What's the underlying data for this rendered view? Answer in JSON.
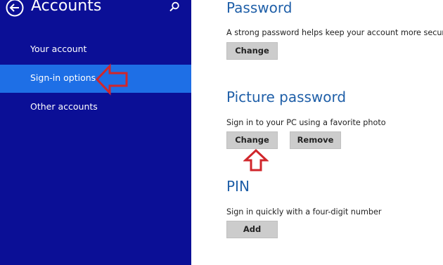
{
  "sidebar": {
    "title": "Accounts",
    "back_icon": "back-arrow-circle-icon",
    "search_icon": "search-icon",
    "background_color": "#0b0f96",
    "selected_color": "#1e6fe6",
    "items": [
      {
        "label": "Your account",
        "selected": false
      },
      {
        "label": "Sign-in options",
        "selected": true
      },
      {
        "label": "Other accounts",
        "selected": false
      }
    ]
  },
  "main": {
    "accent_color": "#1f5fa8",
    "password": {
      "heading": "Password",
      "description": "A strong password helps keep your account more secure",
      "change_label": "Change"
    },
    "picture_password": {
      "heading": "Picture password",
      "description": "Sign in to your PC using a favorite photo",
      "change_label": "Change",
      "remove_label": "Remove"
    },
    "pin": {
      "heading": "PIN",
      "description": "Sign in quickly with a four-digit number",
      "add_label": "Add"
    }
  },
  "annotations": {
    "color": "#d0262b",
    "left_arrow_icon": "red-left-arrow-icon",
    "up_arrow_icon": "red-up-arrow-icon"
  }
}
